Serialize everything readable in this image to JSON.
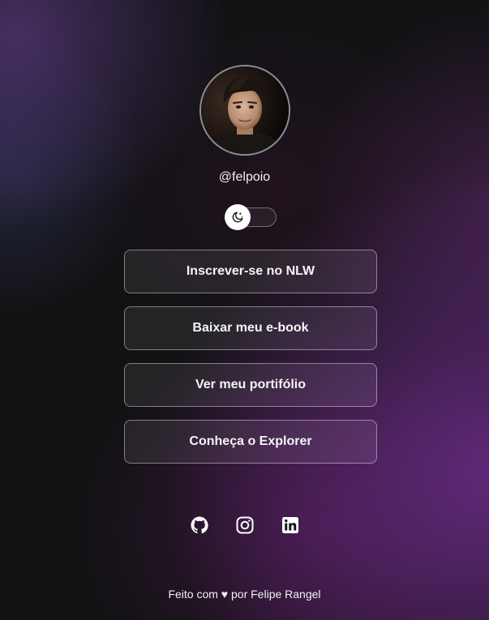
{
  "profile": {
    "username": "@felpoio",
    "avatar_alt": "Foto de perfil"
  },
  "theme_switch": {
    "icon": "moon-stars-icon",
    "state": "dark"
  },
  "links": [
    {
      "label": "Inscrever-se no NLW"
    },
    {
      "label": "Baixar meu e-book"
    },
    {
      "label": "Ver meu portifólio"
    },
    {
      "label": "Conheça o Explorer"
    }
  ],
  "social": [
    {
      "icon": "github-icon"
    },
    {
      "icon": "instagram-icon"
    },
    {
      "icon": "linkedin-icon"
    }
  ],
  "footer": {
    "text": "Feito com ♥ por Felipe Rangel"
  },
  "colors": {
    "background": "#121214",
    "accent_purple": "#6e2d8c",
    "border": "#8d8d99",
    "text": "#f1f1f3"
  }
}
